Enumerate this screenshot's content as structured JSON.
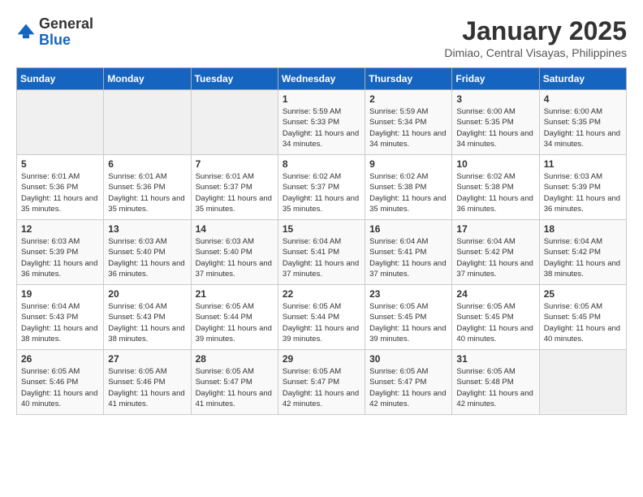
{
  "header": {
    "logo_general": "General",
    "logo_blue": "Blue",
    "month_year": "January 2025",
    "location": "Dimiao, Central Visayas, Philippines"
  },
  "weekdays": [
    "Sunday",
    "Monday",
    "Tuesday",
    "Wednesday",
    "Thursday",
    "Friday",
    "Saturday"
  ],
  "weeks": [
    [
      {
        "day": "",
        "empty": true
      },
      {
        "day": "",
        "empty": true
      },
      {
        "day": "",
        "empty": true
      },
      {
        "day": "1",
        "sunrise": "Sunrise: 5:59 AM",
        "sunset": "Sunset: 5:33 PM",
        "daylight": "Daylight: 11 hours and 34 minutes."
      },
      {
        "day": "2",
        "sunrise": "Sunrise: 5:59 AM",
        "sunset": "Sunset: 5:34 PM",
        "daylight": "Daylight: 11 hours and 34 minutes."
      },
      {
        "day": "3",
        "sunrise": "Sunrise: 6:00 AM",
        "sunset": "Sunset: 5:35 PM",
        "daylight": "Daylight: 11 hours and 34 minutes."
      },
      {
        "day": "4",
        "sunrise": "Sunrise: 6:00 AM",
        "sunset": "Sunset: 5:35 PM",
        "daylight": "Daylight: 11 hours and 34 minutes."
      }
    ],
    [
      {
        "day": "5",
        "sunrise": "Sunrise: 6:01 AM",
        "sunset": "Sunset: 5:36 PM",
        "daylight": "Daylight: 11 hours and 35 minutes."
      },
      {
        "day": "6",
        "sunrise": "Sunrise: 6:01 AM",
        "sunset": "Sunset: 5:36 PM",
        "daylight": "Daylight: 11 hours and 35 minutes."
      },
      {
        "day": "7",
        "sunrise": "Sunrise: 6:01 AM",
        "sunset": "Sunset: 5:37 PM",
        "daylight": "Daylight: 11 hours and 35 minutes."
      },
      {
        "day": "8",
        "sunrise": "Sunrise: 6:02 AM",
        "sunset": "Sunset: 5:37 PM",
        "daylight": "Daylight: 11 hours and 35 minutes."
      },
      {
        "day": "9",
        "sunrise": "Sunrise: 6:02 AM",
        "sunset": "Sunset: 5:38 PM",
        "daylight": "Daylight: 11 hours and 35 minutes."
      },
      {
        "day": "10",
        "sunrise": "Sunrise: 6:02 AM",
        "sunset": "Sunset: 5:38 PM",
        "daylight": "Daylight: 11 hours and 36 minutes."
      },
      {
        "day": "11",
        "sunrise": "Sunrise: 6:03 AM",
        "sunset": "Sunset: 5:39 PM",
        "daylight": "Daylight: 11 hours and 36 minutes."
      }
    ],
    [
      {
        "day": "12",
        "sunrise": "Sunrise: 6:03 AM",
        "sunset": "Sunset: 5:39 PM",
        "daylight": "Daylight: 11 hours and 36 minutes."
      },
      {
        "day": "13",
        "sunrise": "Sunrise: 6:03 AM",
        "sunset": "Sunset: 5:40 PM",
        "daylight": "Daylight: 11 hours and 36 minutes."
      },
      {
        "day": "14",
        "sunrise": "Sunrise: 6:03 AM",
        "sunset": "Sunset: 5:40 PM",
        "daylight": "Daylight: 11 hours and 37 minutes."
      },
      {
        "day": "15",
        "sunrise": "Sunrise: 6:04 AM",
        "sunset": "Sunset: 5:41 PM",
        "daylight": "Daylight: 11 hours and 37 minutes."
      },
      {
        "day": "16",
        "sunrise": "Sunrise: 6:04 AM",
        "sunset": "Sunset: 5:41 PM",
        "daylight": "Daylight: 11 hours and 37 minutes."
      },
      {
        "day": "17",
        "sunrise": "Sunrise: 6:04 AM",
        "sunset": "Sunset: 5:42 PM",
        "daylight": "Daylight: 11 hours and 37 minutes."
      },
      {
        "day": "18",
        "sunrise": "Sunrise: 6:04 AM",
        "sunset": "Sunset: 5:42 PM",
        "daylight": "Daylight: 11 hours and 38 minutes."
      }
    ],
    [
      {
        "day": "19",
        "sunrise": "Sunrise: 6:04 AM",
        "sunset": "Sunset: 5:43 PM",
        "daylight": "Daylight: 11 hours and 38 minutes."
      },
      {
        "day": "20",
        "sunrise": "Sunrise: 6:04 AM",
        "sunset": "Sunset: 5:43 PM",
        "daylight": "Daylight: 11 hours and 38 minutes."
      },
      {
        "day": "21",
        "sunrise": "Sunrise: 6:05 AM",
        "sunset": "Sunset: 5:44 PM",
        "daylight": "Daylight: 11 hours and 39 minutes."
      },
      {
        "day": "22",
        "sunrise": "Sunrise: 6:05 AM",
        "sunset": "Sunset: 5:44 PM",
        "daylight": "Daylight: 11 hours and 39 minutes."
      },
      {
        "day": "23",
        "sunrise": "Sunrise: 6:05 AM",
        "sunset": "Sunset: 5:45 PM",
        "daylight": "Daylight: 11 hours and 39 minutes."
      },
      {
        "day": "24",
        "sunrise": "Sunrise: 6:05 AM",
        "sunset": "Sunset: 5:45 PM",
        "daylight": "Daylight: 11 hours and 40 minutes."
      },
      {
        "day": "25",
        "sunrise": "Sunrise: 6:05 AM",
        "sunset": "Sunset: 5:45 PM",
        "daylight": "Daylight: 11 hours and 40 minutes."
      }
    ],
    [
      {
        "day": "26",
        "sunrise": "Sunrise: 6:05 AM",
        "sunset": "Sunset: 5:46 PM",
        "daylight": "Daylight: 11 hours and 40 minutes."
      },
      {
        "day": "27",
        "sunrise": "Sunrise: 6:05 AM",
        "sunset": "Sunset: 5:46 PM",
        "daylight": "Daylight: 11 hours and 41 minutes."
      },
      {
        "day": "28",
        "sunrise": "Sunrise: 6:05 AM",
        "sunset": "Sunset: 5:47 PM",
        "daylight": "Daylight: 11 hours and 41 minutes."
      },
      {
        "day": "29",
        "sunrise": "Sunrise: 6:05 AM",
        "sunset": "Sunset: 5:47 PM",
        "daylight": "Daylight: 11 hours and 42 minutes."
      },
      {
        "day": "30",
        "sunrise": "Sunrise: 6:05 AM",
        "sunset": "Sunset: 5:47 PM",
        "daylight": "Daylight: 11 hours and 42 minutes."
      },
      {
        "day": "31",
        "sunrise": "Sunrise: 6:05 AM",
        "sunset": "Sunset: 5:48 PM",
        "daylight": "Daylight: 11 hours and 42 minutes."
      },
      {
        "day": "",
        "empty": true
      }
    ]
  ]
}
